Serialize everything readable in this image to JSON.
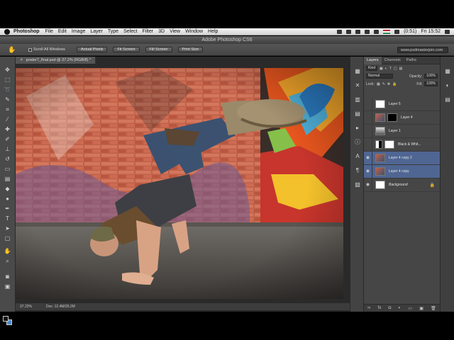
{
  "menubar": {
    "app": "Photoshop",
    "items": [
      "File",
      "Edit",
      "Image",
      "Layer",
      "Type",
      "Select",
      "Filter",
      "3D",
      "View",
      "Window",
      "Help"
    ],
    "battery": "(0:51)",
    "clock": "Fri 15:52"
  },
  "window": {
    "title": "Adobe Photoshop CS6"
  },
  "options": {
    "scroll_all_windows": "Scroll All Windows",
    "buttons": [
      "Actual Pixels",
      "Fit Screen",
      "Fill Screen",
      "Print Size"
    ],
    "workspace": "www.psdmasterjoin.com"
  },
  "document": {
    "tab": "poster7_final.psd @ 37.2% (RGB/8) *",
    "zoom": "37.22%",
    "doc_size": "Doc: 12.4M/35.2M"
  },
  "panel": {
    "tabs": [
      "Layers",
      "Channels",
      "Paths"
    ],
    "kind": "Kind",
    "blend": "Normal",
    "opacity_label": "Opacity:",
    "opacity": "100%",
    "lock_label": "Lock:",
    "fill_label": "Fill:",
    "fill": "100%",
    "layers": [
      {
        "name": "Layer 5"
      },
      {
        "name": "Layer 4"
      },
      {
        "name": "Layer 1"
      },
      {
        "name": "Black & Whit..."
      },
      {
        "name": "Layer 4 copy 2"
      },
      {
        "name": "Layer 4 copy"
      },
      {
        "name": "Background"
      }
    ]
  },
  "colors": {
    "selection": "#4f6693",
    "background_swatch": "#4b89c8"
  }
}
